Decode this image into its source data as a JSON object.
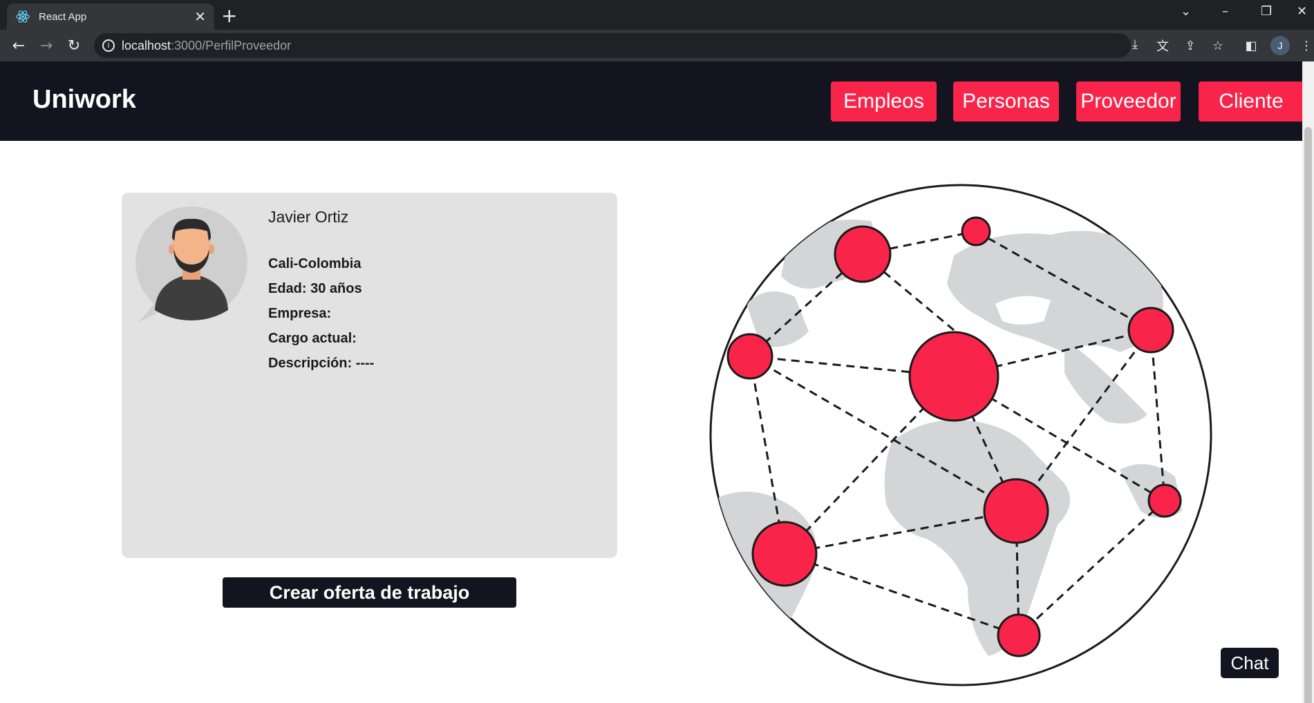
{
  "browser": {
    "tab_title": "React App",
    "url_host": "localhost",
    "url_path": ":3000/PerfilProveedor",
    "profile_initial": "J"
  },
  "header": {
    "brand": "Uniwork",
    "nav": [
      {
        "label": "Empleos"
      },
      {
        "label": "Personas"
      },
      {
        "label": "Proveedor"
      },
      {
        "label": "Cliente"
      }
    ]
  },
  "profile": {
    "name": "Javier Ortiz",
    "location": "Cali-Colombia",
    "age": "Edad: 30 años",
    "company": "Empresa:",
    "position": "Cargo actual:",
    "description": "Descripción: ----"
  },
  "cta": {
    "label": "Crear oferta de trabajo"
  },
  "chat": {
    "label": "Chat"
  },
  "colors": {
    "accent": "#f9244a",
    "dark": "#13141f",
    "card": "#e2e2e2"
  },
  "icons": [
    "react-icon",
    "close-icon",
    "plus-icon",
    "back-icon",
    "forward-icon",
    "reload-icon",
    "info-icon",
    "install-icon",
    "translate-icon",
    "share-icon",
    "star-icon",
    "sidepanel-icon",
    "menu-icon",
    "chevron-down-icon",
    "minimize-icon",
    "restore-icon",
    "window-close-icon"
  ]
}
